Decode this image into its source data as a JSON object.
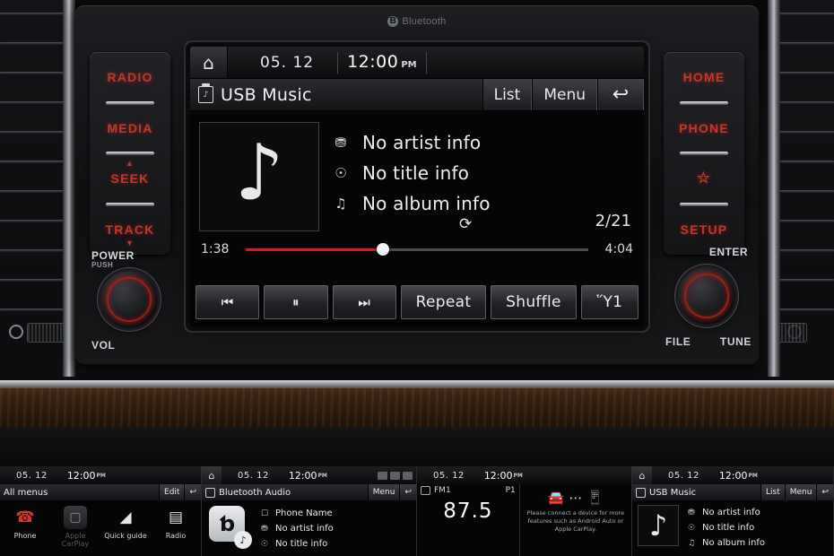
{
  "brand": {
    "bluetooth_label": "Bluetooth",
    "bluetooth_icon": "bluetooth-icon"
  },
  "hard_keys": {
    "left": [
      {
        "label": "RADIO",
        "name": "radio-key"
      },
      {
        "label": "MEDIA",
        "name": "media-key"
      },
      {
        "label": "SEEK",
        "name": "seek-key",
        "arrow": "up"
      },
      {
        "label": "TRACK",
        "name": "track-key",
        "arrow": "down"
      }
    ],
    "right": [
      {
        "label": "HOME",
        "name": "home-key"
      },
      {
        "label": "PHONE",
        "name": "phone-key"
      },
      {
        "label": "☆",
        "name": "favorite-star-key"
      },
      {
        "label": "SETUP",
        "name": "setup-key"
      }
    ]
  },
  "knobs": {
    "left": {
      "top": "POWER",
      "sub": "PUSH",
      "bottom": "VOL"
    },
    "right": {
      "top": "ENTER",
      "bottom_left": "FILE",
      "bottom_right": "TUNE"
    }
  },
  "screen": {
    "status": {
      "home_icon": "⌂",
      "date": "05. 12",
      "time": "12:00",
      "ampm": "PM"
    },
    "title": {
      "icon": "usb-music-icon",
      "text": "USB Music",
      "list_label": "List",
      "menu_label": "Menu",
      "back_icon": "↩"
    },
    "album_art": {
      "icon": "music-note-icon",
      "glyph": "♪"
    },
    "metadata": [
      {
        "icon": "⛃",
        "icon_name": "artist-icon",
        "text": "No artist info"
      },
      {
        "icon": "☉",
        "icon_name": "title-icon",
        "text": "No title info"
      },
      {
        "icon": "♫",
        "icon_name": "album-icon",
        "text": "No album info"
      }
    ],
    "repeat_indicator": "⟳",
    "track_counter": "2/21",
    "progress": {
      "elapsed": "1:38",
      "total": "4:04",
      "percent": 40,
      "accent": "#d21f16"
    },
    "controls": [
      {
        "label": "⏮",
        "name": "previous-track-button",
        "style": "icon"
      },
      {
        "label": "⏸",
        "name": "pause-button",
        "style": "icon"
      },
      {
        "label": "⏭",
        "name": "next-track-button",
        "style": "icon"
      },
      {
        "label": "Repeat",
        "name": "repeat-button",
        "style": "wide"
      },
      {
        "label": "Shuffle",
        "name": "shuffle-button",
        "style": "wide"
      },
      {
        "label": "Ὕ1",
        "name": "delete-button",
        "style": "narrow"
      }
    ]
  },
  "thumbnails": [
    {
      "name": "all-menus-screen",
      "status": {
        "date": "05. 12",
        "time": "12:00",
        "ampm": "PM"
      },
      "title": "All menus",
      "buttons": [
        "Edit"
      ],
      "back_icon": "↩",
      "menu_items": [
        {
          "label": "Phone",
          "icon": "☎",
          "dim": false
        },
        {
          "label": "Apple CarPlay",
          "icon": "▢",
          "dim": true
        },
        {
          "label": "Quick guide",
          "icon": "◢",
          "dim": false
        },
        {
          "label": "Radio",
          "icon": "▤",
          "dim": false
        }
      ]
    },
    {
      "name": "bluetooth-audio-screen",
      "status": {
        "date": "05. 12",
        "time": "12:00",
        "ampm": "PM"
      },
      "title": "Bluetooth Audio",
      "buttons": [
        "Menu"
      ],
      "back_icon": "↩",
      "lines": [
        {
          "icon": "☐",
          "text": "Phone Name"
        },
        {
          "icon": "⛃",
          "text": "No artist info"
        },
        {
          "icon": "☉",
          "text": "No title info"
        }
      ]
    },
    {
      "name": "radio-screen",
      "status": {
        "date": "05. 12",
        "time": "12:00",
        "ampm": "PM"
      },
      "band": "FM1",
      "preset": "P1",
      "frequency": "87.5",
      "connect_message": "Please connect a device for more features such as Android Auto or Apple CarPlay."
    },
    {
      "name": "usb-music-screen",
      "status": {
        "date": "05. 12",
        "time": "12:00",
        "ampm": "PM"
      },
      "title": "USB Music",
      "buttons": [
        "List",
        "Menu"
      ],
      "back_icon": "↩",
      "lines": [
        {
          "icon": "⛃",
          "text": "No artist info"
        },
        {
          "icon": "☉",
          "text": "No title info"
        },
        {
          "icon": "♫",
          "text": "No album info"
        }
      ]
    }
  ]
}
